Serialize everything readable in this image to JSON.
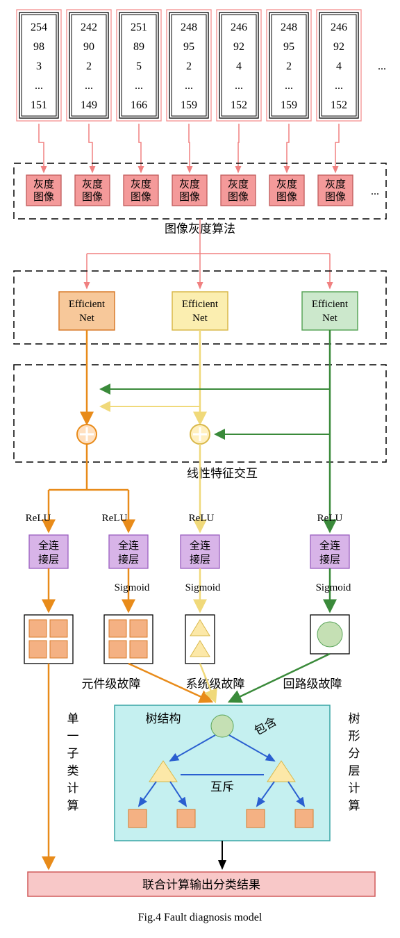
{
  "columns": [
    {
      "vals": [
        "254",
        "98",
        "3",
        "...",
        "151"
      ]
    },
    {
      "vals": [
        "242",
        "90",
        "2",
        "...",
        "149"
      ]
    },
    {
      "vals": [
        "251",
        "89",
        "5",
        "...",
        "166"
      ]
    },
    {
      "vals": [
        "248",
        "95",
        "2",
        "...",
        "159"
      ]
    },
    {
      "vals": [
        "246",
        "92",
        "4",
        "...",
        "152"
      ]
    },
    {
      "vals": [
        "248",
        "95",
        "2",
        "...",
        "159"
      ]
    },
    {
      "vals": [
        "246",
        "92",
        "4",
        "...",
        "152"
      ]
    }
  ],
  "ellipsis": "...",
  "gray_img": "灰度图像",
  "gray_algo": "图像灰度算法",
  "effnet": "Efficient Net",
  "linear_interact": "线性特征交互",
  "relu": "ReLU",
  "fc_layer": "全连接层",
  "sigmoid": "Sigmoid",
  "fault_component": "元件级故障",
  "fault_system": "系统级故障",
  "fault_circuit": "回路级故障",
  "single_calc": "单一子类计算",
  "tree_calc": "树形分层计算",
  "tree_struct": "树结构",
  "include": "包含",
  "exclusive": "互斥",
  "joint_output": "联合计算输出分类结果",
  "caption": "Fig.4 Fault diagnosis model"
}
